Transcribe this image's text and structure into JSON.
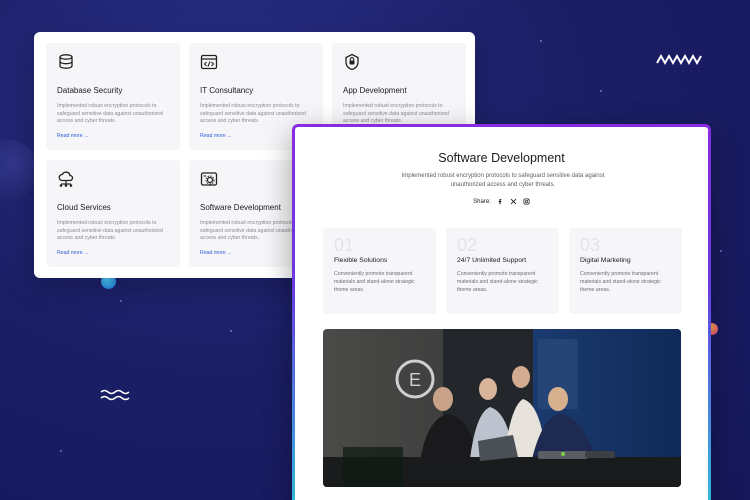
{
  "services": [
    {
      "title": "Database Security",
      "icon": "database-lock-icon",
      "desc": "Implemented robust encryption protocols to safeguard sensitive data against unauthorized access and cyber threats.",
      "link": "Read more ..."
    },
    {
      "title": "IT Consultancy",
      "icon": "code-window-icon",
      "desc": "Implemented robust encryption protocols to safeguard sensitive data against unauthorized access and cyber threats.",
      "link": "Read more ..."
    },
    {
      "title": "App Development",
      "icon": "app-shield-icon",
      "desc": "Implemented robust encryption protocols to safeguard sensitive data against unauthorized access and cyber threats.",
      "link": ""
    },
    {
      "title": "Cloud Services",
      "icon": "cloud-network-icon",
      "desc": "Implemented robust encryption protocols to safeguard sensitive data against unauthorized access and cyber threats.",
      "link": "Read more ..."
    },
    {
      "title": "Software Development",
      "icon": "software-gear-icon",
      "desc": "Implemented robust encryption protocols to safeguard sensitive data against unauthorized access and cyber threats.",
      "link": "Read more ..."
    }
  ],
  "detail": {
    "title": "Software Development",
    "desc": "Implemented robust encryption protocols to safeguard sensitive data against unauthorized access and cyber threats.",
    "share_label": "Share:",
    "share_icons": [
      "facebook-icon",
      "x-icon",
      "instagram-icon"
    ]
  },
  "features": [
    {
      "num": "01",
      "title": "Flexible Solutions",
      "desc": "Conveniently promote transparent materials and stand-alone strategic theme areas."
    },
    {
      "num": "02",
      "title": "24/7 Unlimited Support",
      "desc": "Conveniently promote transparent materials and stand-alone strategic theme areas."
    },
    {
      "num": "03",
      "title": "Digital Marketing",
      "desc": "Conveniently promote transparent materials and stand-alone strategic theme areas."
    }
  ],
  "colors": {
    "background": "#1b1f66",
    "accent": "#2f5bd8",
    "border_gradient_top": "#8a2be2",
    "border_gradient_bottom": "#2fc0d8"
  }
}
